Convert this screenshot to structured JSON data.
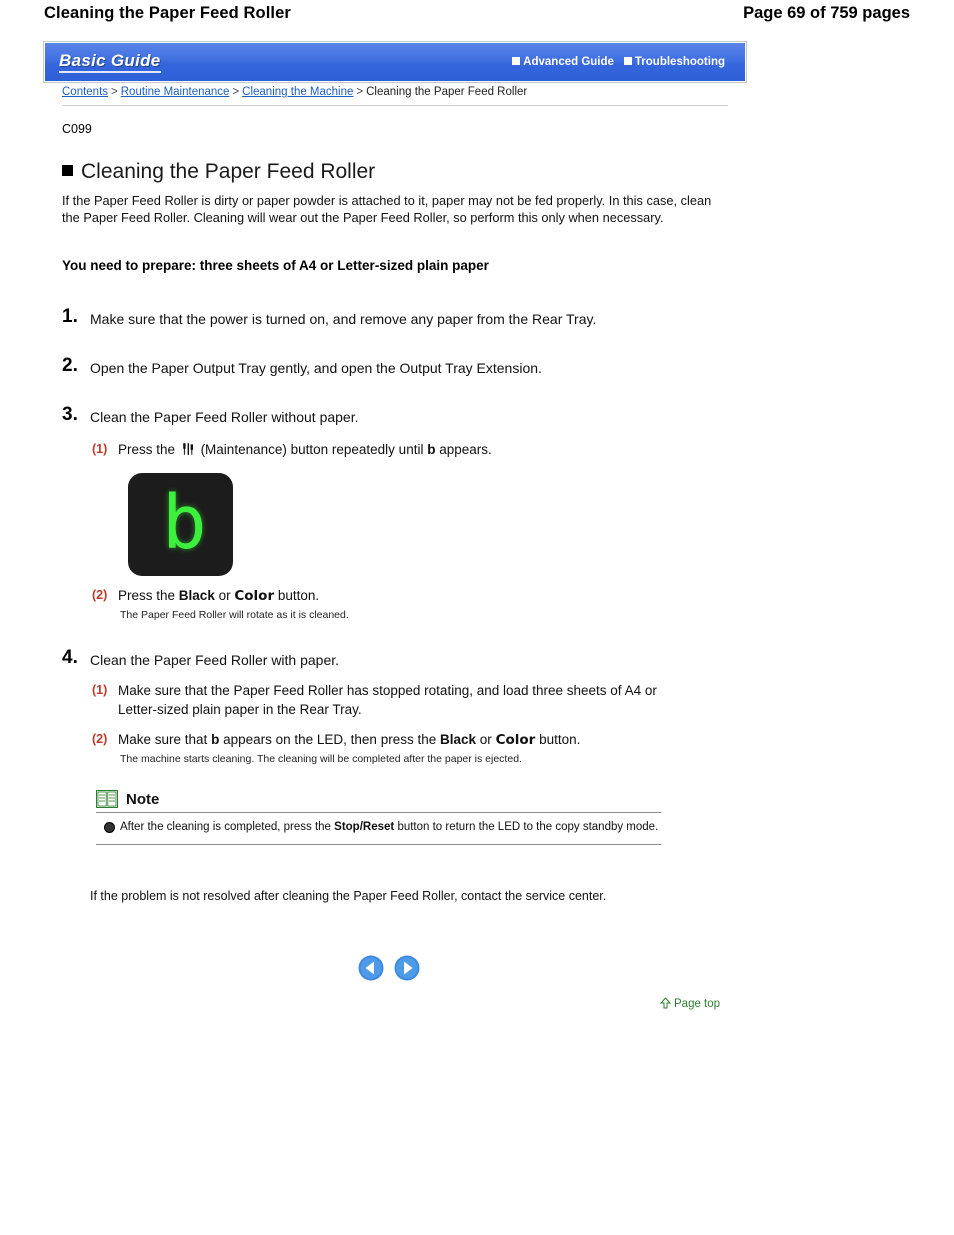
{
  "page_header": {
    "title": "Cleaning the Paper Feed Roller",
    "page_label": "Page 69 of 759 pages"
  },
  "guide_bar": {
    "logo": "Basic Guide",
    "links": [
      {
        "label": "Advanced Guide",
        "icon": "white-square-icon"
      },
      {
        "label": "Troubleshooting",
        "icon": "white-square-icon"
      }
    ]
  },
  "breadcrumb": {
    "items": [
      {
        "label": "Contents",
        "link": true
      },
      {
        "label": "Routine Maintenance",
        "link": true
      },
      {
        "label": "Cleaning the Machine",
        "link": true
      },
      {
        "label": "Cleaning the Paper Feed Roller",
        "link": false
      }
    ],
    "separator": ">"
  },
  "doc_code": "C099",
  "heading": "Cleaning the Paper Feed Roller",
  "intro": "If the Paper Feed Roller is dirty or paper powder is attached to it, paper may not be fed properly. In this case, clean the Paper Feed Roller. Cleaning will wear out the Paper Feed Roller, so perform this only when necessary.",
  "prepare": "You need to prepare: three sheets of A4 or Letter-sized plain paper",
  "steps": [
    {
      "num": "1.",
      "text": "Make sure that the power is turned on, and remove any paper from the Rear Tray."
    },
    {
      "num": "2.",
      "text": "Open the Paper Output Tray gently, and open the Output Tray Extension."
    },
    {
      "num": "3.",
      "text": "Clean the Paper Feed Roller without paper."
    },
    {
      "num": "4.",
      "text": "Clean the Paper Feed Roller with paper."
    }
  ],
  "step3": {
    "sub1_label": "(1)",
    "sub1_part1": "Press the",
    "sub1_icon": "maintenance-button-icon",
    "sub1_part2": "(Maintenance) button repeatedly until",
    "sub1_code": "b",
    "sub1_part3": "appears.",
    "led_value": "b",
    "sub2_label": "(2)",
    "sub2_part1": "Press the",
    "sub2_black": "Black",
    "sub2_or": "or",
    "sub2_color": "Color",
    "sub2_part2": "button.",
    "sub2_note": "The Paper Feed Roller will rotate as it is cleaned."
  },
  "step4": {
    "sub1_label": "(1)",
    "sub1_text": "Make sure that the Paper Feed Roller has stopped rotating, and load three sheets of A4 or Letter-sized plain paper in the Rear Tray.",
    "sub2_label": "(2)",
    "sub2_part1": "Make sure that",
    "sub2_code": "b",
    "sub2_part2": "appears on the LED, then press the",
    "sub2_black": "Black",
    "sub2_or": "or",
    "sub2_color": "Color",
    "sub2_part3": "button.",
    "sub2_note": "The machine starts cleaning. The cleaning will be completed after the paper is ejected."
  },
  "note": {
    "icon": "note-book-icon",
    "title": "Note",
    "part1": "After the cleaning is completed, press the",
    "bold": "Stop/Reset",
    "part2": "button to return the LED to the copy standby mode."
  },
  "closing": "If the problem is not resolved after cleaning the Paper Feed Roller, contact the service center.",
  "nav": {
    "prev": "previous-page-arrow",
    "next": "next-page-arrow"
  },
  "page_top": {
    "label": "Page top",
    "icon": "up-arrow-icon"
  },
  "colors": {
    "link": "#1d5fc4",
    "substep_label": "#c0392b",
    "guide_bar": "#3566dc",
    "led_green": "#3ef03e",
    "page_top": "#2f7d32"
  }
}
